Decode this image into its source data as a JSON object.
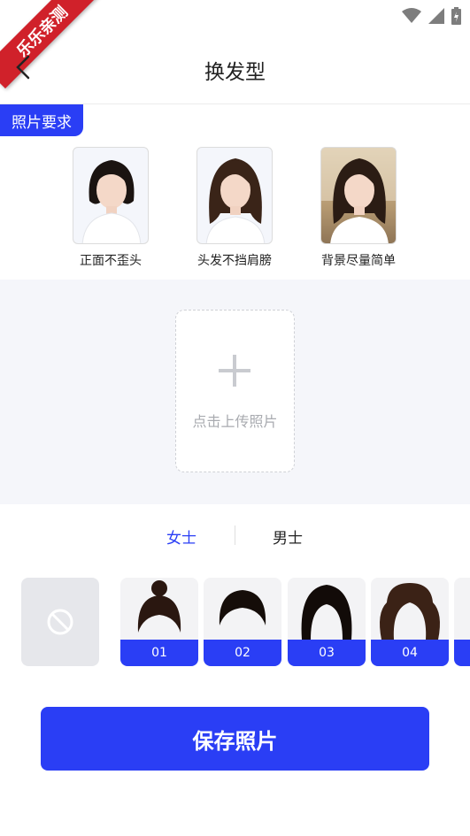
{
  "ribbon": {
    "text": "乐乐亲测"
  },
  "nav": {
    "title": "换发型",
    "back_icon": "back-arrow-icon"
  },
  "requirements": {
    "tag": "照片要求",
    "samples": [
      {
        "label": "正面不歪头"
      },
      {
        "label": "头发不挡肩膀"
      },
      {
        "label": "背景尽量简单"
      }
    ]
  },
  "upload": {
    "text": "点击上传照片",
    "icon": "plus-icon"
  },
  "gender_tabs": {
    "female": "女士",
    "male": "男士",
    "active": "female"
  },
  "hairstyles": {
    "none_icon": "prohibited-icon",
    "items": [
      {
        "number": "01"
      },
      {
        "number": "02"
      },
      {
        "number": "03"
      },
      {
        "number": "04"
      }
    ]
  },
  "save_button": {
    "label": "保存照片"
  },
  "colors": {
    "accent": "#2a3ef5",
    "ribbon": "#d0212a",
    "upload_bg": "#f5f6fa"
  }
}
